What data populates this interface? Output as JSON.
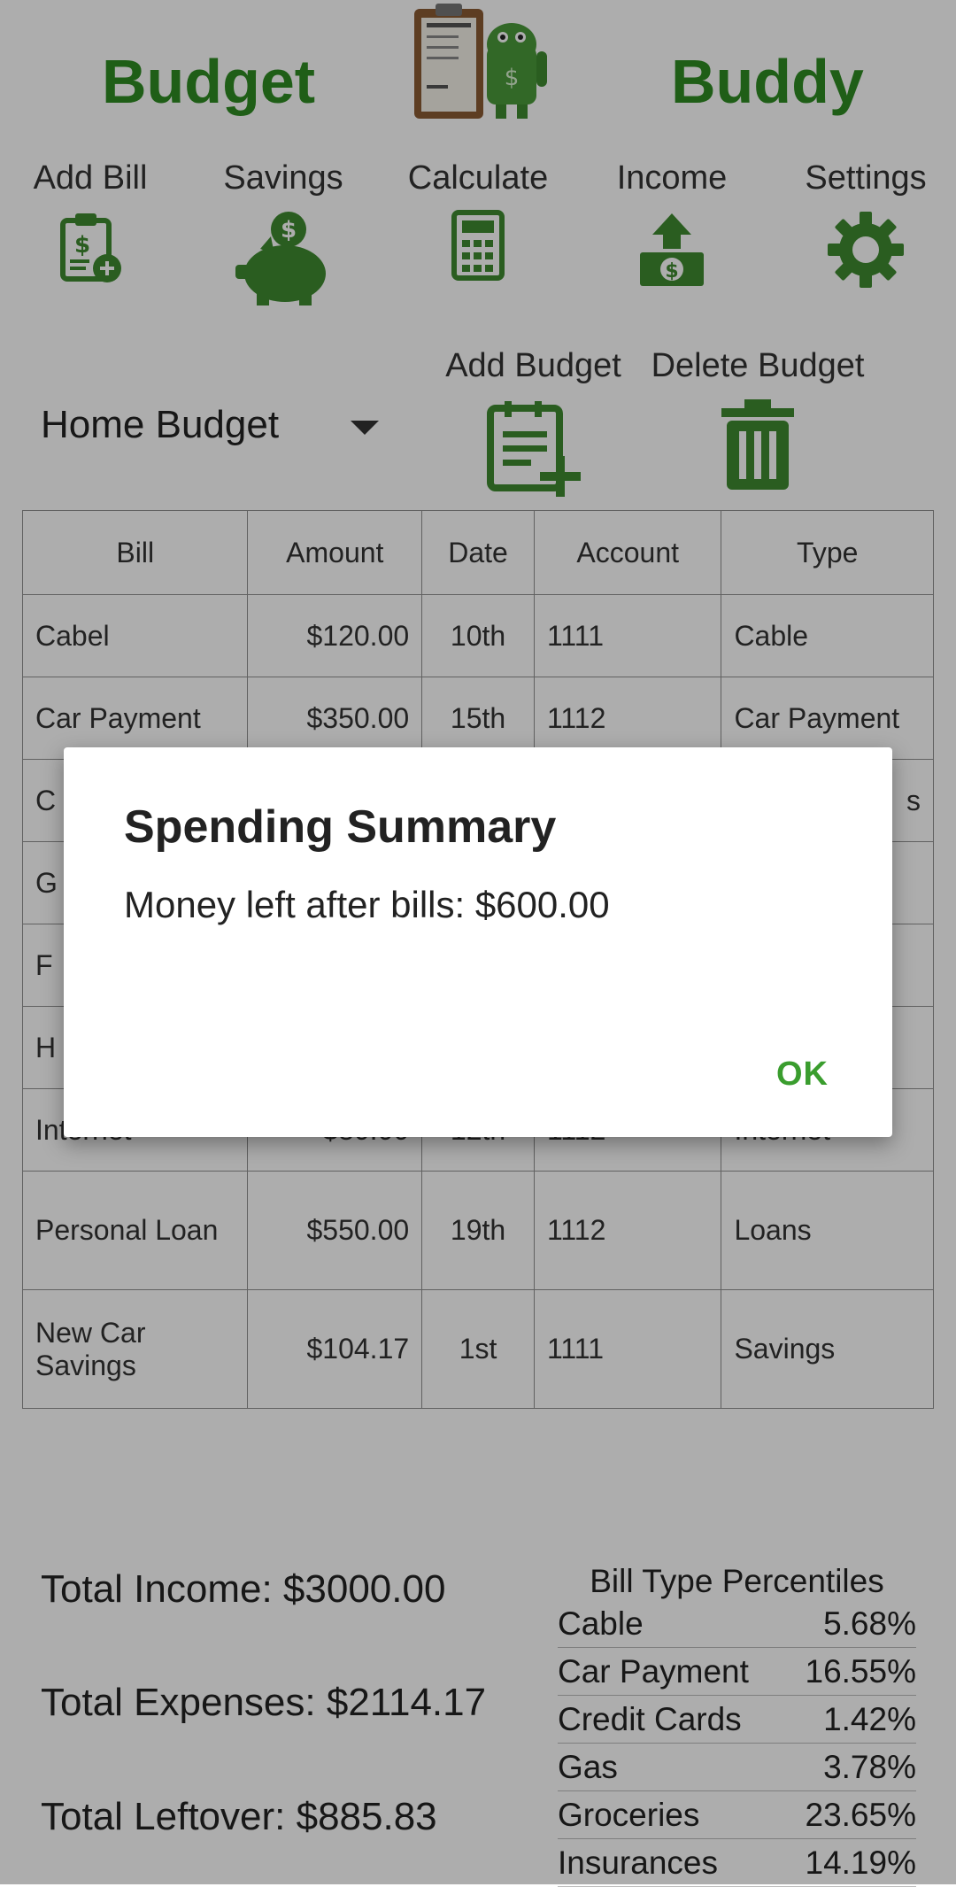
{
  "header": {
    "title_left": "Budget",
    "title_right": "Buddy",
    "logo_icon": "budget-clipboard-android-logo",
    "brand_color": "#2e8b22"
  },
  "toolbar": [
    {
      "label": "Add Bill",
      "icon": "clipboard-add-icon"
    },
    {
      "label": "Savings",
      "icon": "piggy-bank-icon"
    },
    {
      "label": "Calculate",
      "icon": "calculator-icon"
    },
    {
      "label": "Income",
      "icon": "money-upload-icon"
    },
    {
      "label": "Settings",
      "icon": "gear-icon"
    }
  ],
  "budget": {
    "selected": "Home Budget",
    "add_label": "Add Budget",
    "delete_label": "Delete Budget"
  },
  "table": {
    "headers": [
      "Bill",
      "Amount",
      "Date",
      "Account",
      "Type"
    ],
    "rows": [
      {
        "bill": "Cabel",
        "amount": "$120.00",
        "date": "10th",
        "account": "1111",
        "type": "Cable"
      },
      {
        "bill": "Car Payment",
        "amount": "$350.00",
        "date": "15th",
        "account": "1112",
        "type": "Car Payment"
      },
      {
        "bill": "C",
        "amount": "",
        "date": "",
        "account": "",
        "type": "s"
      },
      {
        "bill": "G",
        "amount": "",
        "date": "",
        "account": "",
        "type": ""
      },
      {
        "bill": "F",
        "amount": "",
        "date": "",
        "account": "",
        "type": ""
      },
      {
        "bill": "H",
        "amount": "",
        "date": "",
        "account": "",
        "type": ""
      },
      {
        "bill": "Internet",
        "amount": "$80.00",
        "date": "12th",
        "account": "1112",
        "type": "Internet"
      },
      {
        "bill": "Personal Loan",
        "amount": "$550.00",
        "date": "19th",
        "account": "1112",
        "type": "Loans"
      },
      {
        "bill": "New Car Savings",
        "amount": "$104.17",
        "date": "1st",
        "account": "1111",
        "type": "Savings"
      }
    ]
  },
  "totals": {
    "income": "Total Income: $3000.00",
    "expenses": "Total Expenses: $2114.17",
    "leftover": "Total Leftover: $885.83"
  },
  "percentiles": {
    "title": "Bill Type Percentiles",
    "rows": [
      {
        "type": "Cable",
        "pct": "5.68%"
      },
      {
        "type": "Car Payment",
        "pct": "16.55%"
      },
      {
        "type": "Credit Cards",
        "pct": "1.42%"
      },
      {
        "type": "Gas",
        "pct": "3.78%"
      },
      {
        "type": "Groceries",
        "pct": "23.65%"
      },
      {
        "type": "Insurances",
        "pct": "14.19%"
      }
    ]
  },
  "dialog": {
    "title": "Spending Summary",
    "message": "Money left after bills: $600.00",
    "ok_label": "OK",
    "accent_color": "#3a9d2e"
  }
}
